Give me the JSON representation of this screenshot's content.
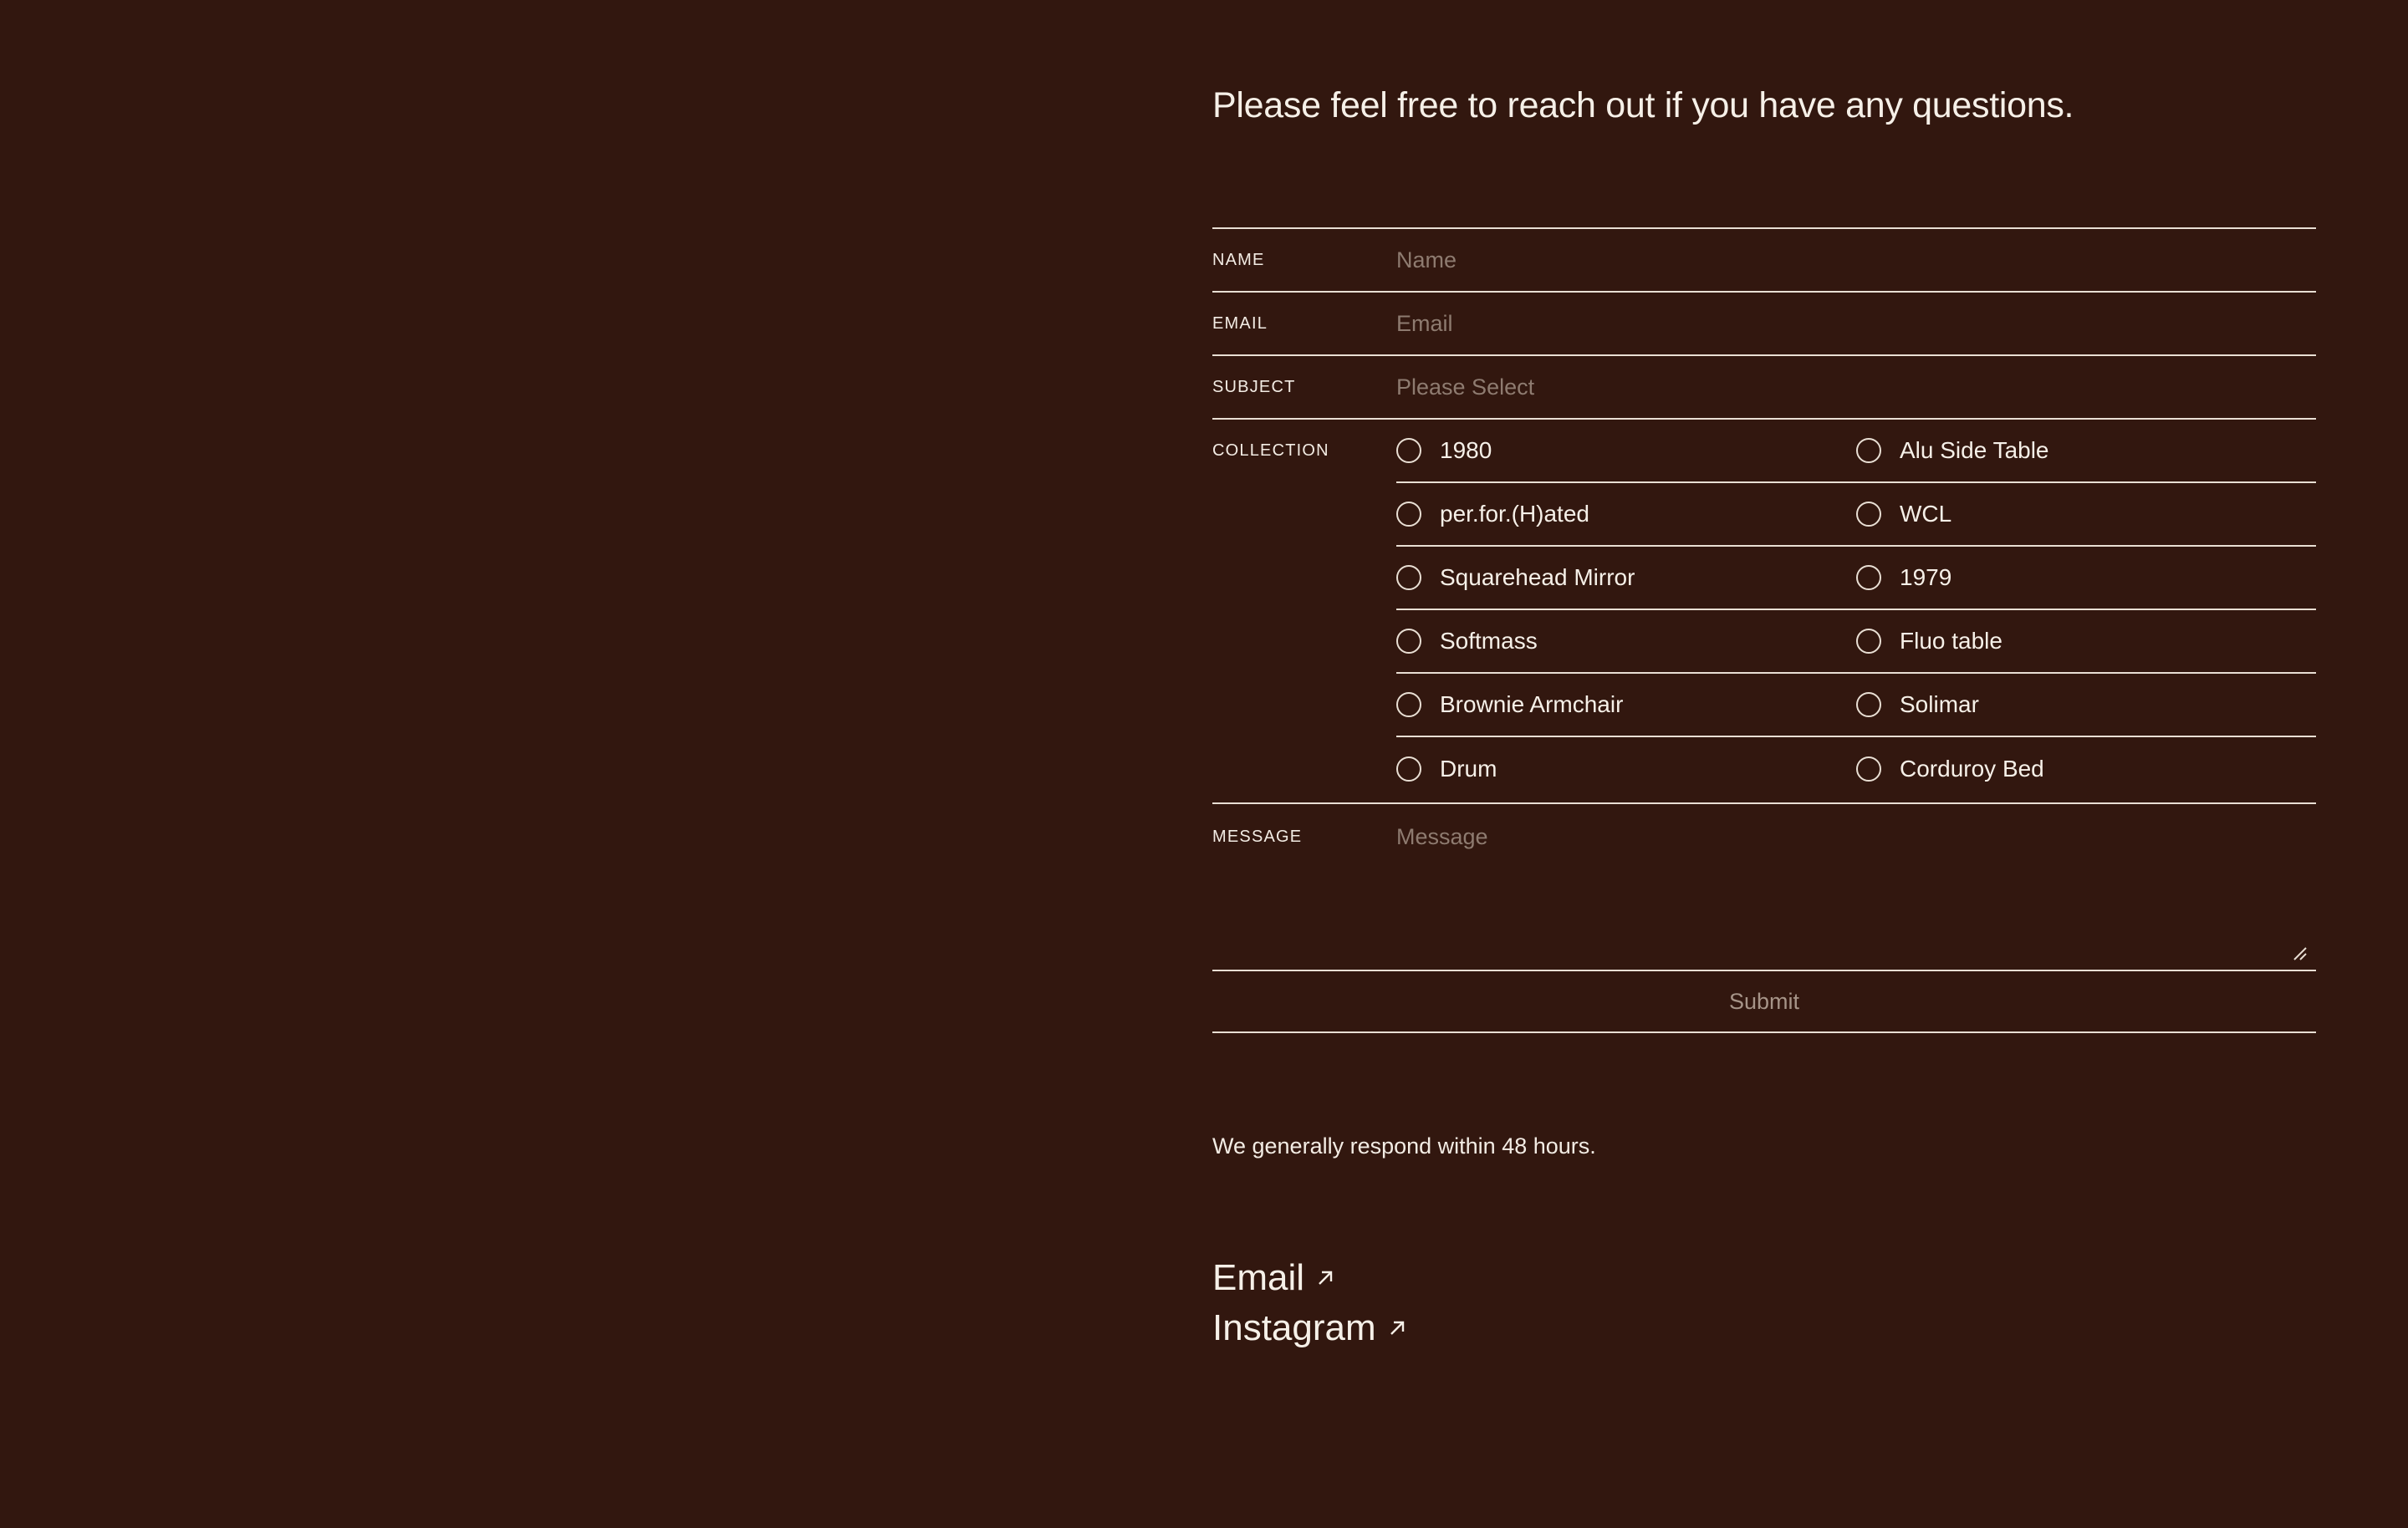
{
  "heading": "Please feel free to reach out if you have any questions.",
  "form": {
    "name_label": "NAME",
    "name_placeholder": "Name",
    "email_label": "EMAIL",
    "email_placeholder": "Email",
    "subject_label": "SUBJECT",
    "subject_placeholder": "Please Select",
    "collection_label": "COLLECTION",
    "collection_options": [
      [
        "1980",
        "Alu Side Table"
      ],
      [
        "per.for.(H)ated",
        "WCL"
      ],
      [
        "Squarehead Mirror",
        "1979"
      ],
      [
        "Softmass",
        "Fluo table"
      ],
      [
        "Brownie Armchair",
        "Solimar"
      ],
      [
        "Drum",
        "Corduroy Bed"
      ]
    ],
    "message_label": "MESSAGE",
    "message_placeholder": "Message",
    "submit_label": "Submit"
  },
  "respond_text": "We generally respond within 48 hours.",
  "links": {
    "email": "Email",
    "instagram": "Instagram"
  },
  "icons": {
    "radio": "radio-empty-icon",
    "arrow": "arrow-up-right-icon",
    "resize": "resize-grip-icon"
  },
  "colors": {
    "background": "#32170f",
    "text": "#f3ece4",
    "placeholder": "#8e7b70",
    "rule": "#e9dfd4"
  }
}
